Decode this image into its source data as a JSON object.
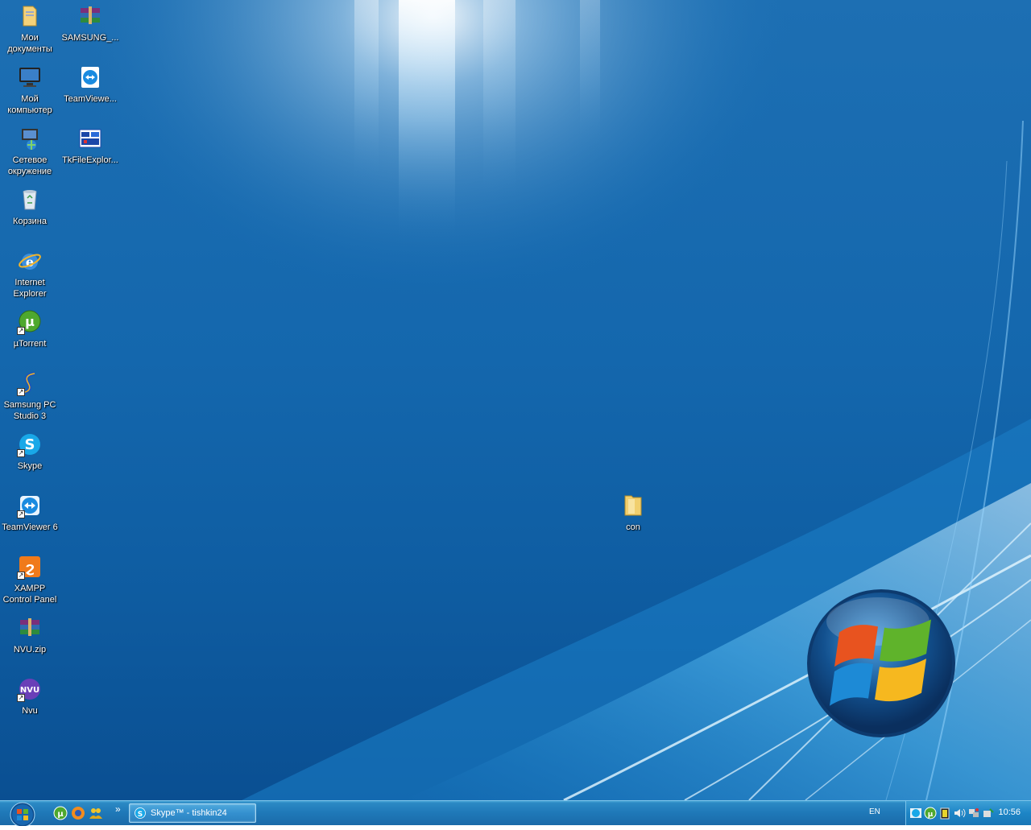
{
  "desktop": {
    "icons": [
      {
        "id": "my-documents",
        "label": "Мои документы",
        "icon": "folder-documents-icon",
        "shortcut": false
      },
      {
        "id": "samsung-archive",
        "label": "SAMSUNG_...",
        "icon": "winrar-archive-icon",
        "shortcut": false
      },
      {
        "id": "my-computer",
        "label": "Мой компьютер",
        "icon": "monitor-icon",
        "shortcut": false
      },
      {
        "id": "teamviewer-file",
        "label": "TeamViewe...",
        "icon": "teamviewer-icon",
        "shortcut": false
      },
      {
        "id": "network",
        "label": "Сетевое окружение",
        "icon": "network-icon",
        "shortcut": false
      },
      {
        "id": "tkfileexplorer",
        "label": "TkFileExplor...",
        "icon": "tk-explorer-icon",
        "shortcut": false
      },
      {
        "id": "recycle-bin",
        "label": "Корзина",
        "icon": "recycle-bin-icon",
        "shortcut": false
      },
      {
        "id": "internet-explorer",
        "label": "Internet Explorer",
        "icon": "ie-icon",
        "shortcut": false
      },
      {
        "id": "utorrent",
        "label": "µTorrent",
        "icon": "utorrent-icon",
        "shortcut": true
      },
      {
        "id": "samsung-pc-studio",
        "label": "Samsung PC Studio 3",
        "icon": "samsung-studio-icon",
        "shortcut": true
      },
      {
        "id": "skype",
        "label": "Skype",
        "icon": "skype-icon",
        "shortcut": true
      },
      {
        "id": "teamviewer6",
        "label": "TeamViewer 6",
        "icon": "teamviewer-icon",
        "shortcut": true
      },
      {
        "id": "xampp",
        "label": "XAMPP Control Panel",
        "icon": "xampp-icon",
        "shortcut": true
      },
      {
        "id": "nvu-zip",
        "label": "NVU.zip",
        "icon": "winrar-archive-icon",
        "shortcut": false
      },
      {
        "id": "nvu",
        "label": "Nvu",
        "icon": "nvu-icon",
        "shortcut": true
      },
      {
        "id": "con-folder",
        "label": "con",
        "icon": "folder-icon",
        "shortcut": false
      }
    ]
  },
  "taskbar": {
    "start_button": "start-orb-icon",
    "quick_launch": [
      "utorrent-icon",
      "firefox-icon",
      "users-icon"
    ],
    "chevron": "»",
    "tasks": [
      {
        "label": "Skype™ - tishkin24",
        "icon": "skype-icon"
      }
    ],
    "language": "EN",
    "tray_icons": [
      "skype-tray-icon",
      "utorrent-tray-icon",
      "battery-icon",
      "volume-icon",
      "network-tray-icon",
      "safely-remove-icon"
    ],
    "clock": "10:56"
  },
  "colors": {
    "desktop_bg": "#1467ad",
    "taskbar": "#1f78b8",
    "accent": "#4aa6d6"
  }
}
